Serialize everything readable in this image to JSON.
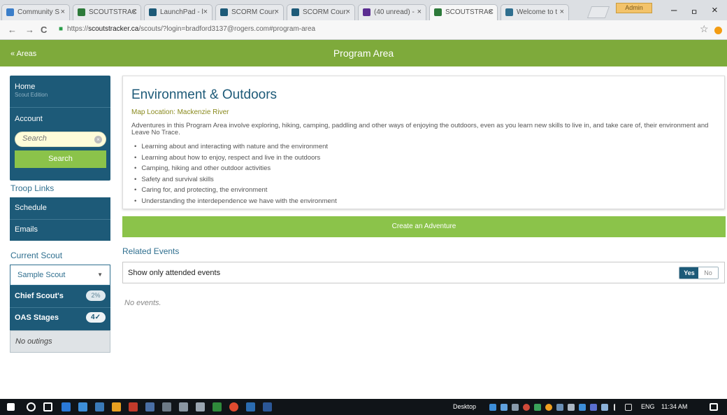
{
  "browser": {
    "tabs": [
      {
        "title": "Community S",
        "color": "#3b7ec9",
        "active": false
      },
      {
        "title": "SCOUTSTRAC",
        "color": "#2d7a3a",
        "active": false
      },
      {
        "title": "LaunchPad - l",
        "color": "#1d5a78",
        "active": false
      },
      {
        "title": "SCORM Cour:",
        "color": "#1d5a78",
        "active": false
      },
      {
        "title": "SCORM Cour:",
        "color": "#1d5a78",
        "active": false
      },
      {
        "title": "(40 unread) -",
        "color": "#5b2d91",
        "active": false
      },
      {
        "title": "SCOUTSTRAC",
        "color": "#2d7a3a",
        "active": true
      },
      {
        "title": "Welcome to t",
        "color": "#2f6f8f",
        "active": false
      }
    ],
    "close_glyph": "×",
    "profile_label": "Admin",
    "window": {
      "minimize": "–",
      "maximize": "ㅁ",
      "close": "×"
    },
    "nav": {
      "back": "←",
      "forward": "→",
      "reload": "C"
    },
    "url": {
      "scheme": "https://",
      "host": "scoutstracker.ca",
      "path": "/scouts/?login=bradford3137@rogers.com#program-area"
    },
    "star_glyph": "☆"
  },
  "appbar": {
    "back_label": "« Areas",
    "title": "Program Area"
  },
  "sidebar": {
    "home": "Home",
    "edition": "Scout Edition",
    "account": "Account",
    "search_placeholder": "Search",
    "clear_glyph": "×",
    "search_button": "Search",
    "troop_links_heading": "Troop Links",
    "troop_links": [
      "Schedule",
      "Emails"
    ],
    "current_scout_heading": "Current Scout",
    "current_scout": "Sample Scout",
    "caret": "▼",
    "progress": [
      {
        "label": "Chief Scout's",
        "badge": "2%"
      },
      {
        "label": "OAS Stages",
        "badge": "4✓"
      }
    ],
    "outings": "No outings"
  },
  "main": {
    "title": "Environment & Outdoors",
    "map_location": "Map Location: Mackenzie River",
    "intro": "Adventures in this Program Area involve exploring, hiking, camping, paddling and other ways of enjoying the outdoors, even as you learn new skills to live in, and take care of, their environment and Leave No Trace.",
    "bullets": [
      "Learning about and interacting with nature and the environment",
      "Learning about how to enjoy, respect and live in the outdoors",
      "Camping, hiking and other outdoor activities",
      "Safety and survival skills",
      "Caring for, and protecting, the environment",
      "Understanding the interdependence we have with the environment"
    ],
    "create_button": "Create an Adventure",
    "related_heading": "Related Events",
    "attended_label": "Show only attended events",
    "toggle_yes": "Yes",
    "toggle_no": "No",
    "no_events": "No events."
  },
  "taskbar": {
    "desktop_label": "Desktop",
    "lang": "ENG",
    "time": "11:34 AM"
  },
  "colors": {
    "brand_green": "#7eaa3b",
    "button_green": "#8bc34a",
    "navy": "#1d5a78"
  }
}
